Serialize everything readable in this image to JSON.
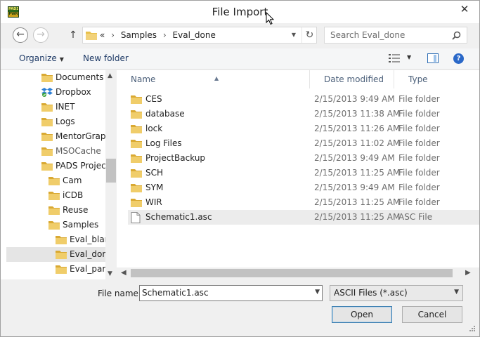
{
  "window": {
    "title": "File Import",
    "app_icon_text_top": "PADS",
    "app_icon_text_bottom": "PWR",
    "close_glyph": "✕"
  },
  "address": {
    "overflow": "«",
    "crumbs": [
      "Samples",
      "Eval_done"
    ],
    "separator": "›",
    "search_placeholder": "Search Eval_done"
  },
  "toolbar": {
    "organize_label": "Organize",
    "new_folder_label": "New folder",
    "help_glyph": "?"
  },
  "nav": {
    "items": [
      {
        "label": "Documents",
        "icon": "folder-icon"
      },
      {
        "label": "Dropbox",
        "icon": "dropbox-icon"
      },
      {
        "label": "INET",
        "icon": "folder-icon"
      },
      {
        "label": "Logs",
        "icon": "folder-icon"
      },
      {
        "label": "MentorGraph",
        "icon": "folder-icon"
      },
      {
        "label": "MSOCache",
        "icon": "folder-icon"
      },
      {
        "label": "PADS Project",
        "icon": "folder-icon"
      },
      {
        "label": "Cam",
        "icon": "folder-icon"
      },
      {
        "label": "iCDB",
        "icon": "folder-icon"
      },
      {
        "label": "Reuse",
        "icon": "folder-icon"
      },
      {
        "label": "Samples",
        "icon": "folder-icon"
      },
      {
        "label": "Eval_blan",
        "icon": "folder-icon"
      },
      {
        "label": "Eval_done",
        "icon": "folder-icon"
      },
      {
        "label": "Eval_parti",
        "icon": "folder-icon"
      }
    ]
  },
  "columns": {
    "name": "Name",
    "date": "Date modified",
    "type": "Type"
  },
  "files": [
    {
      "name": "CES",
      "date": "2/15/2013 9:49 AM",
      "type": "File folder",
      "icon": "folder-icon"
    },
    {
      "name": "database",
      "date": "2/15/2013 11:38 AM",
      "type": "File folder",
      "icon": "folder-icon"
    },
    {
      "name": "lock",
      "date": "2/15/2013 11:26 AM",
      "type": "File folder",
      "icon": "folder-icon"
    },
    {
      "name": "Log Files",
      "date": "2/15/2013 11:02 AM",
      "type": "File folder",
      "icon": "folder-icon"
    },
    {
      "name": "ProjectBackup",
      "date": "2/15/2013 9:49 AM",
      "type": "File folder",
      "icon": "folder-icon"
    },
    {
      "name": "SCH",
      "date": "2/15/2013 11:25 AM",
      "type": "File folder",
      "icon": "folder-icon"
    },
    {
      "name": "SYM",
      "date": "2/15/2013 9:49 AM",
      "type": "File folder",
      "icon": "folder-icon"
    },
    {
      "name": "WIR",
      "date": "2/15/2013 11:25 AM",
      "type": "File folder",
      "icon": "folder-icon"
    },
    {
      "name": "Schematic1.asc",
      "date": "2/15/2013 11:25 AM",
      "type": "ASC File",
      "icon": "document-icon"
    }
  ],
  "footer": {
    "file_name_label": "File name:",
    "file_name_value": "Schematic1.asc",
    "file_type_value": "ASCII Files (*.asc)",
    "open_label": "Open",
    "cancel_label": "Cancel"
  },
  "colors": {
    "folder": "#e8c04a",
    "selection": "#e5e5e5",
    "accent": "#2a68c8"
  }
}
